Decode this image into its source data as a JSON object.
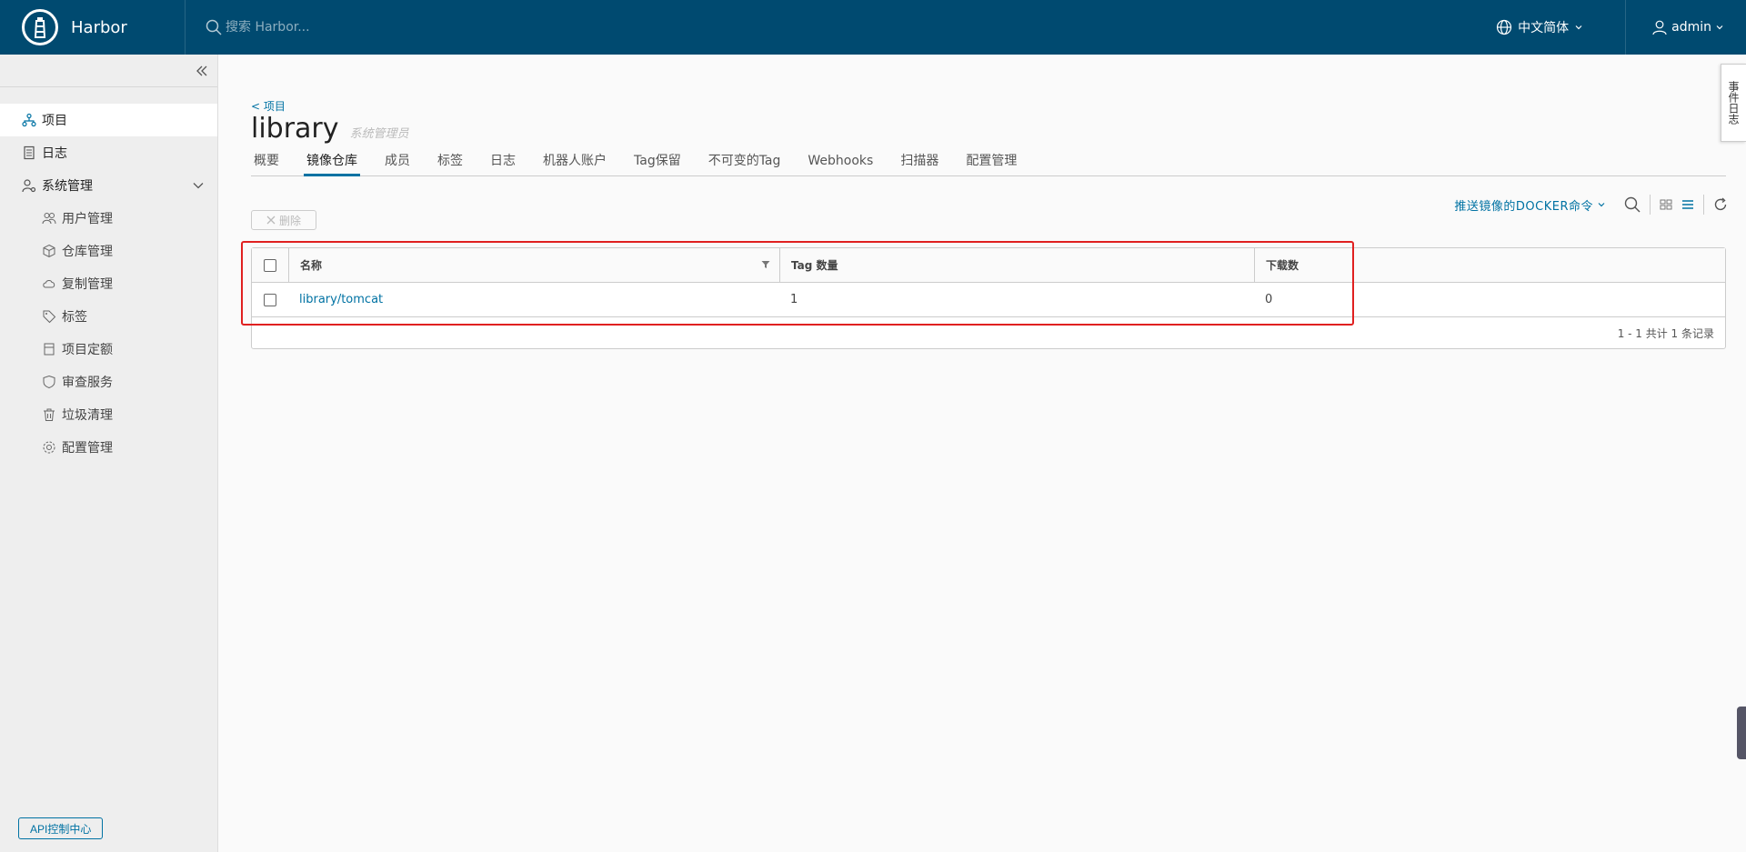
{
  "header": {
    "brand": "Harbor",
    "search_placeholder": "搜索 Harbor...",
    "language": "中文简体",
    "user": "admin"
  },
  "sidebar": {
    "items": [
      {
        "label": "项目",
        "icon": "projects-icon"
      },
      {
        "label": "日志",
        "icon": "logs-icon"
      },
      {
        "label": "系统管理",
        "icon": "admin-icon"
      }
    ],
    "sub_items": [
      {
        "label": "用户管理",
        "icon": "users-icon"
      },
      {
        "label": "仓库管理",
        "icon": "registry-icon"
      },
      {
        "label": "复制管理",
        "icon": "replication-icon"
      },
      {
        "label": "标签",
        "icon": "tag-icon"
      },
      {
        "label": "项目定额",
        "icon": "quota-icon"
      },
      {
        "label": "审查服务",
        "icon": "shield-icon"
      },
      {
        "label": "垃圾清理",
        "icon": "trash-icon"
      },
      {
        "label": "配置管理",
        "icon": "gear-icon"
      }
    ],
    "api_button": "API控制中心"
  },
  "main": {
    "breadcrumb": "< 项目",
    "title": "library",
    "role": "系统管理员",
    "tabs": [
      "概要",
      "镜像仓库",
      "成员",
      "标签",
      "日志",
      "机器人账户",
      "Tag保留",
      "不可变的Tag",
      "Webhooks",
      "扫描器",
      "配置管理"
    ],
    "active_tab": "镜像仓库",
    "push_command": "推送镜像的DOCKER命令",
    "delete_button": "删除",
    "table": {
      "columns": [
        "名称",
        "Tag 数量",
        "下载数"
      ],
      "rows": [
        {
          "name": "library/tomcat",
          "tags": "1",
          "downloads": "0"
        }
      ],
      "footer": "1 - 1 共计 1 条记录"
    },
    "side_tab": "事件日志"
  },
  "colors": {
    "header_bg": "#004a70",
    "accent": "#0072a3",
    "highlight": "#e02020"
  }
}
